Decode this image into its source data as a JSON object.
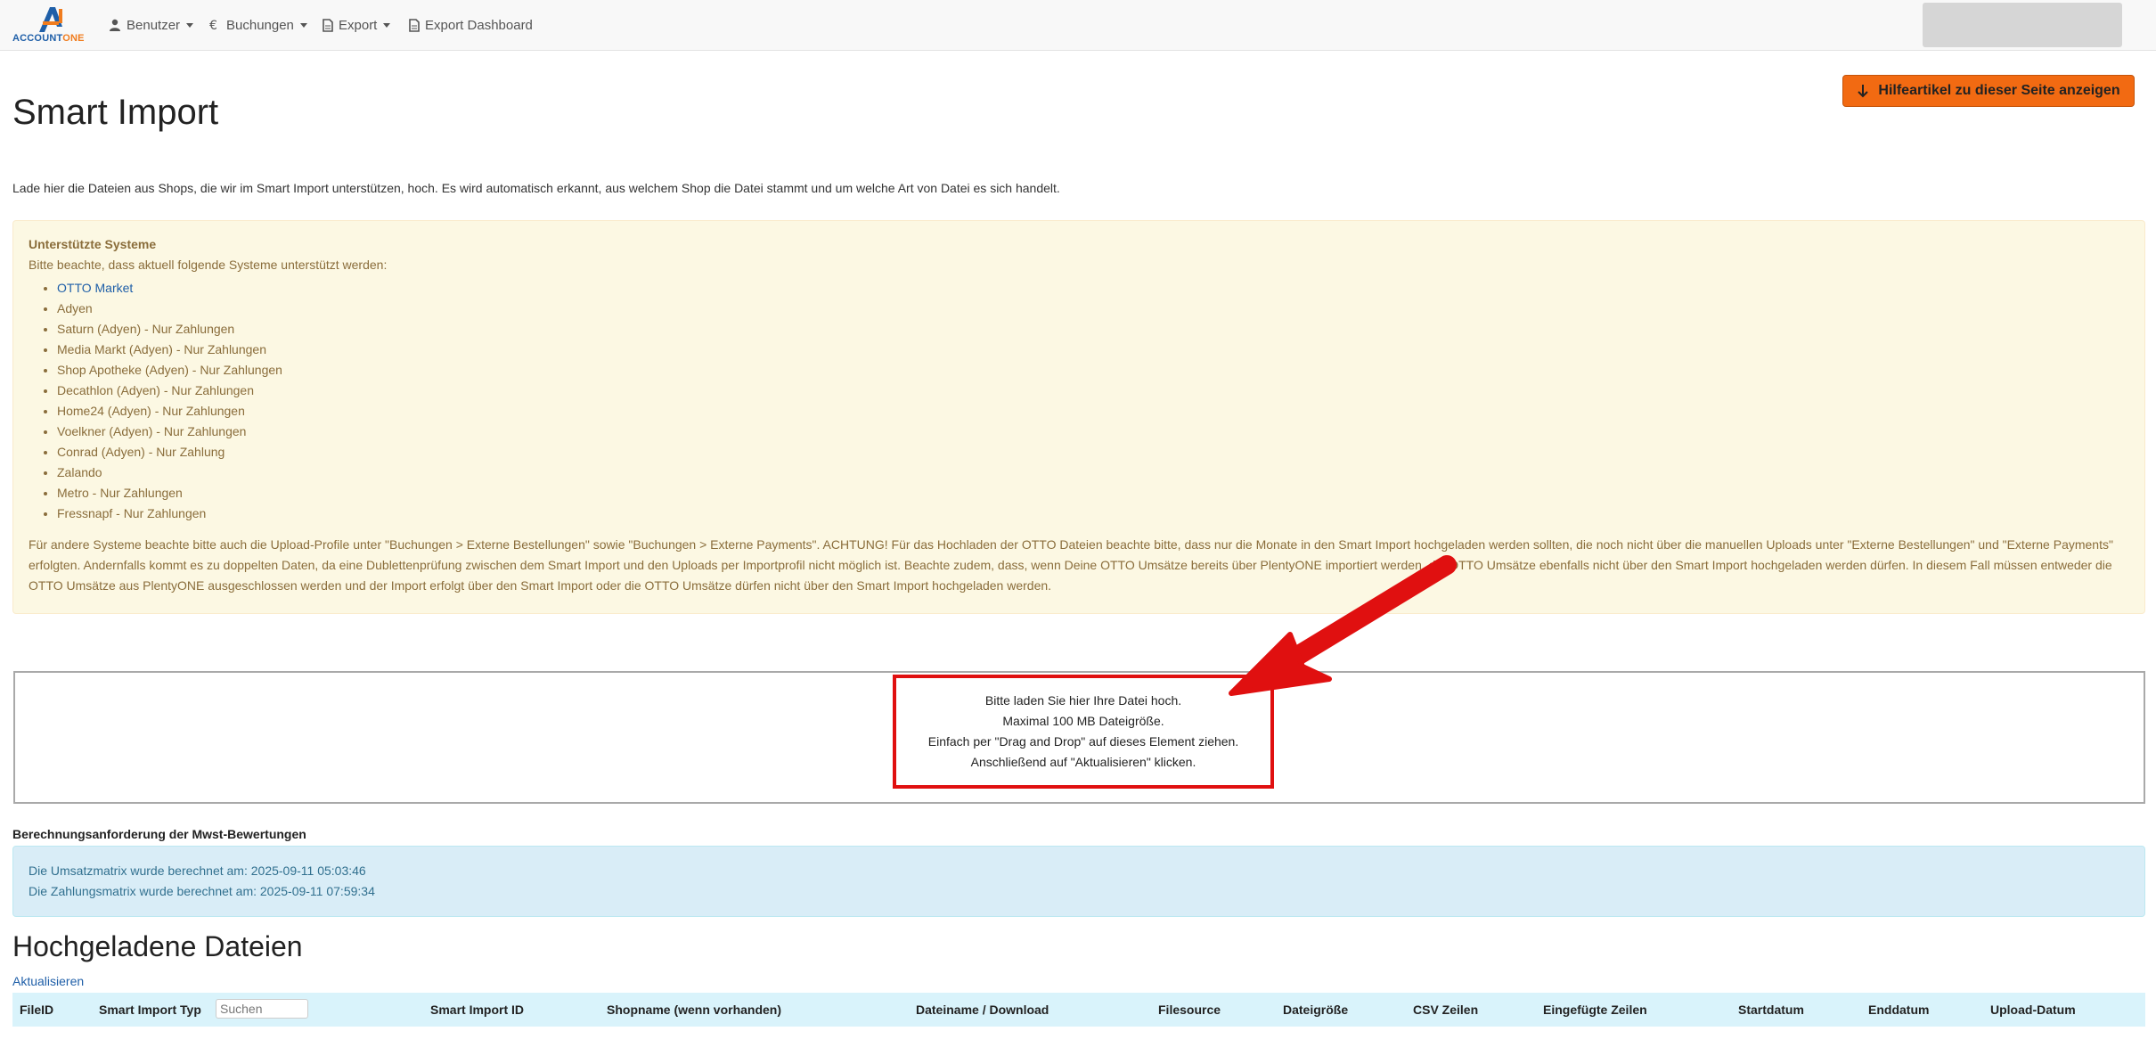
{
  "logo": {
    "part1": "ACCOUNT",
    "part2": "ONE"
  },
  "nav": {
    "items": [
      {
        "label": "Benutzer",
        "icon": "user-icon",
        "dropdown": true
      },
      {
        "label": "Buchungen",
        "icon": "euro-icon",
        "dropdown": true
      },
      {
        "label": "Export",
        "icon": "document-icon",
        "dropdown": true
      },
      {
        "label": "Export Dashboard",
        "icon": "document-icon",
        "dropdown": false
      }
    ]
  },
  "help_button": {
    "label": "Hilfeartikel zu dieser Seite anzeigen",
    "icon": "arrow-down-icon"
  },
  "page": {
    "title": "Smart Import",
    "intro": "Lade hier die Dateien aus Shops, die wir im Smart Import unterstützen, hoch. Es wird automatisch erkannt, aus welchem Shop die Datei stammt und um welche Art von Datei es sich handelt."
  },
  "supported": {
    "title": "Unterstützte Systeme",
    "subtitle": "Bitte beachte, dass aktuell folgende Systeme unterstützt werden:",
    "items": [
      "OTTO Market",
      "Adyen",
      "Saturn (Adyen) - Nur Zahlungen",
      "Media Markt (Adyen) - Nur Zahlungen",
      "Shop Apotheke (Adyen) - Nur Zahlungen",
      "Decathlon (Adyen) - Nur Zahlungen",
      "Home24 (Adyen) - Nur Zahlungen",
      "Voelkner (Adyen) - Nur Zahlungen",
      "Conrad (Adyen) - Nur Zahlung",
      "Zalando",
      "Metro - Nur Zahlungen",
      "Fressnapf - Nur Zahlungen"
    ],
    "note": "Für andere Systeme beachte bitte auch die Upload-Profile unter \"Buchungen > Externe Bestellungen\" sowie \"Buchungen > Externe Payments\". ACHTUNG! Für das Hochladen der OTTO Dateien beachte bitte, dass nur die Monate in den Smart Import hochgeladen werden sollten, die noch nicht über die manuellen Uploads unter \"Externe Bestellungen\" und \"Externe Payments\" erfolgten. Andernfalls kommt es zu doppelten Daten, da eine Dublettenprüfung zwischen dem Smart Import und den Uploads per Importprofil nicht möglich ist. Beachte zudem, dass, wenn Deine OTTO Umsätze bereits über PlentyONE importiert werden, die OTTO Umsätze ebenfalls nicht über den Smart Import hochgeladen werden dürfen. In diesem Fall müssen entweder die OTTO Umsätze aus PlentyONE ausgeschlossen werden und der Import erfolgt über den Smart Import oder die OTTO Umsätze dürfen nicht über den Smart Import hochgeladen werden."
  },
  "dropzone": {
    "line1": "Bitte laden Sie hier Ihre Datei hoch.",
    "line2": "Maximal 100 MB Dateigröße.",
    "line3": "Einfach per \"Drag and Drop\" auf dieses Element ziehen.",
    "line4": "Anschließend auf \"Aktualisieren\" klicken."
  },
  "vat": {
    "heading": "Berechnungsanforderung der Mwst-Bewertungen",
    "line1": "Die Umsatzmatrix wurde berechnet am: 2025-09-11 05:03:46",
    "line2": "Die Zahlungsmatrix wurde berechnet am: 2025-09-11 07:59:34"
  },
  "uploads": {
    "title": "Hochgeladene Dateien",
    "refresh_label": "Aktualisieren",
    "search_placeholder": "Suchen",
    "columns": [
      "FileID",
      "Smart Import Typ",
      "Smart Import ID",
      "Shopname (wenn vorhanden)",
      "Dateiname / Download",
      "Filesource",
      "Dateigröße",
      "CSV Zeilen",
      "Eingefügte Zeilen",
      "Startdatum",
      "Enddatum",
      "Upload-Datum"
    ]
  },
  "colors": {
    "accent_orange": "#f26a12",
    "annotation_red": "#e01010",
    "warning_bg": "#fcf8e3",
    "info_bg": "#d9edf7",
    "table_header_bg": "#d9f3fb"
  }
}
